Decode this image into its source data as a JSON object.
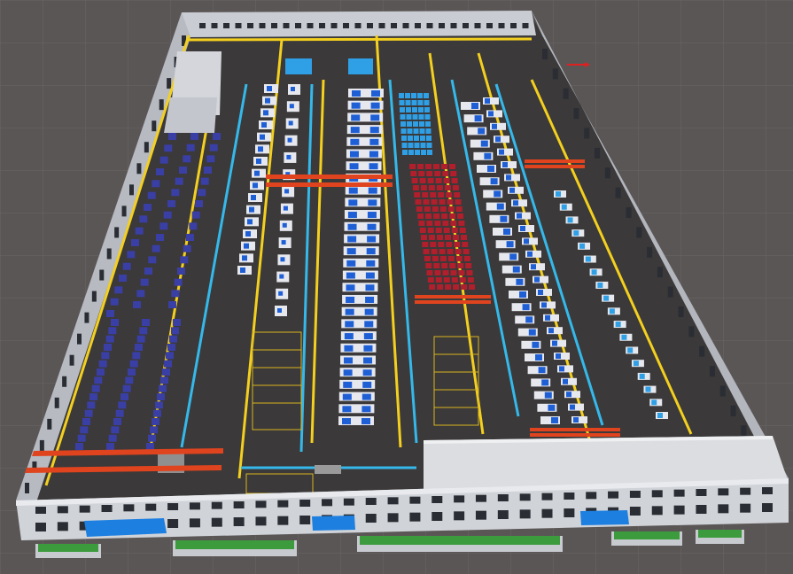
{
  "scene": {
    "view": "3d-factory-floor-plan",
    "colors": {
      "background": "#5b5656",
      "grid": "#6a6565",
      "wall": "#c9ccd2",
      "wall_dark": "#8d9097",
      "window": "#2a2d33",
      "floor": "#3b3939",
      "yellow_line": "#f3cf1f",
      "cyan_line": "#35b8ea",
      "red_beam": "#e0441f",
      "rack_blue": "#3a3fa6",
      "rack_red": "#b11e2c",
      "machine_white": "#e6e8ee",
      "machine_blue": "#1f5fd6",
      "pallet_blue": "#2f9fe6",
      "awning_blue": "#1d7fe0",
      "planter_green": "#3c9b3c",
      "office_roof": "#dcdde0"
    },
    "zones": [
      "storage-racks-left",
      "cnc-machine-line-1",
      "cnc-machine-line-2",
      "blue-pallet-area",
      "red-rack-area",
      "machine-line-right",
      "machine-line-far-right",
      "office-block"
    ],
    "axis_marker_color": "#e02020"
  }
}
